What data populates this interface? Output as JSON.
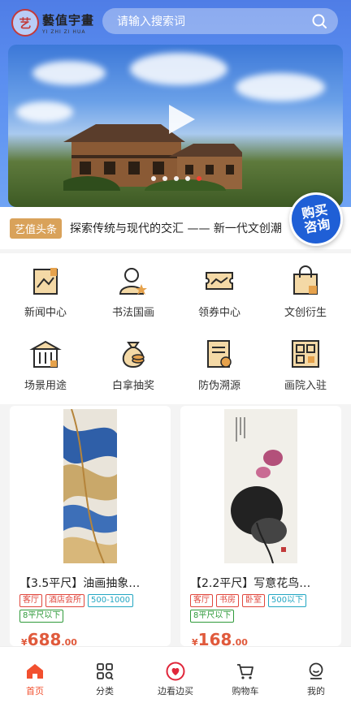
{
  "header": {
    "logo_cn": "藝值宇畫",
    "logo_en": "YI ZHI ZI HUA",
    "logo_seal": "艺",
    "search_placeholder": "请输入搜索词"
  },
  "banner": {
    "slide_count": 5,
    "active_slide": 5
  },
  "news": {
    "tag": "艺值头条",
    "text": "探索传统与现代的交汇 —— 新一代文创潮"
  },
  "buy_badge": {
    "line1": "购买",
    "line2": "咨询"
  },
  "grid": {
    "items": [
      {
        "label": "新闻中心",
        "icon": "news-icon"
      },
      {
        "label": "书法国画",
        "icon": "artist-icon"
      },
      {
        "label": "领券中心",
        "icon": "coupon-icon"
      },
      {
        "label": "文创衍生",
        "icon": "shopping-bag-icon"
      },
      {
        "label": "场景用途",
        "icon": "building-icon"
      },
      {
        "label": "白拿抽奖",
        "icon": "money-bag-icon"
      },
      {
        "label": "防伪溯源",
        "icon": "certificate-icon"
      },
      {
        "label": "画院入驻",
        "icon": "qr-code-icon"
      }
    ]
  },
  "products": [
    {
      "title": "【3.5平尺】油画抽象…",
      "tags": [
        {
          "text": "客厅",
          "color": "red"
        },
        {
          "text": "酒店会所",
          "color": "red"
        },
        {
          "text": "500-1000",
          "color": "cyan"
        },
        {
          "text": "8平尺以下",
          "color": "green"
        }
      ],
      "price_symbol": "¥",
      "price_int": "688",
      "price_dec": ".00"
    },
    {
      "title": "【2.2平尺】写意花鸟…",
      "tags": [
        {
          "text": "客厅",
          "color": "red"
        },
        {
          "text": "书房",
          "color": "red"
        },
        {
          "text": "卧室",
          "color": "red"
        },
        {
          "text": "500以下",
          "color": "cyan"
        },
        {
          "text": "8平尺以下",
          "color": "green"
        }
      ],
      "price_symbol": "¥",
      "price_int": "168",
      "price_dec": ".00"
    }
  ],
  "tabbar": {
    "items": [
      {
        "label": "首页",
        "icon": "home-icon",
        "active": true
      },
      {
        "label": "分类",
        "icon": "category-icon",
        "active": false
      },
      {
        "label": "边看边买",
        "icon": "live-heart-icon",
        "active": false
      },
      {
        "label": "购物车",
        "icon": "cart-icon",
        "active": false
      },
      {
        "label": "我的",
        "icon": "profile-icon",
        "active": false
      }
    ]
  },
  "colors": {
    "accent": "#f2502f",
    "header_blue": "#5b8ff0",
    "tag_gold": "#d9a25a",
    "price": "#e05a3c"
  }
}
